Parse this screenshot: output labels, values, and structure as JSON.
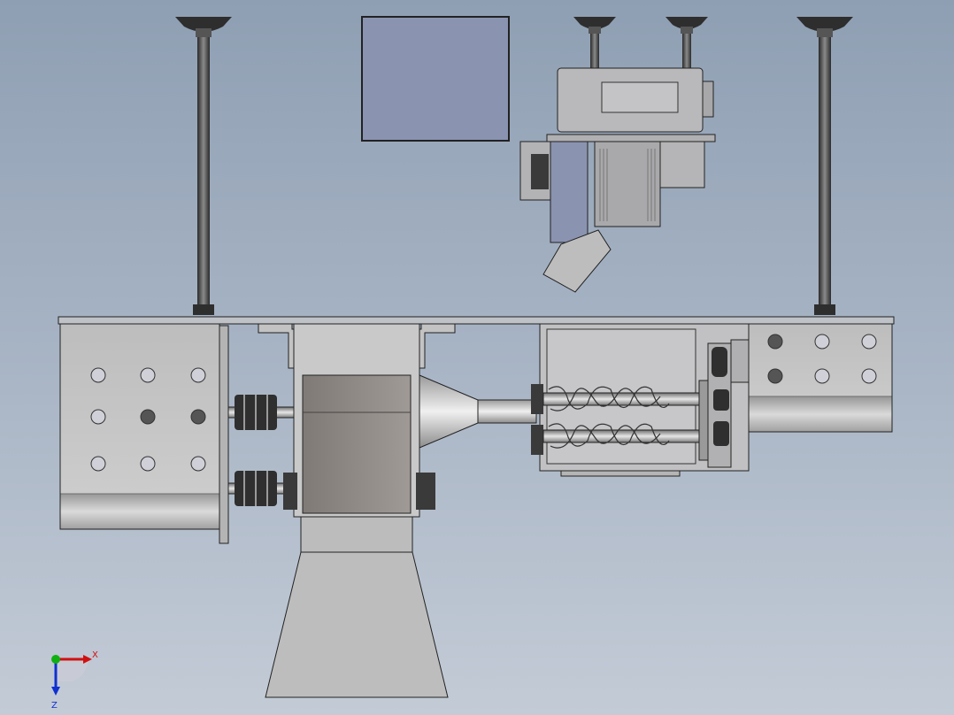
{
  "view": {
    "type": "cad-drawing",
    "description_free": true,
    "axis_triad": {
      "x_label": "X",
      "z_label": "Z",
      "colors": {
        "x": "#d01010",
        "y": "#10b010",
        "z": "#1030d0"
      }
    }
  },
  "colors": {
    "background_top": "#8f9fb3",
    "background_bottom": "#c3cbd6",
    "metal_light": "#c8c8ca",
    "metal_mid": "#9a9694",
    "metal_dark": "#3b3b3b",
    "panel_blue": "#8a93b0",
    "edge": "#222222"
  }
}
